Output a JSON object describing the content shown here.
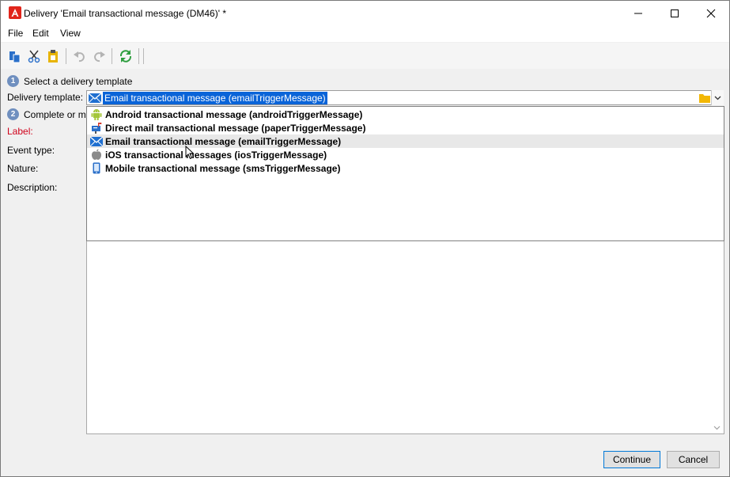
{
  "window": {
    "title": "Delivery 'Email transactional message (DM46)' *"
  },
  "menu": {
    "file": "File",
    "edit": "Edit",
    "view": "View"
  },
  "steps": {
    "step1": {
      "number": "1",
      "label": "Select a delivery template"
    },
    "step2": {
      "number": "2",
      "label": "Complete or m"
    }
  },
  "fields": {
    "delivery_template_label": "Delivery template:",
    "label_label": "Label:",
    "event_type_label": "Event type:",
    "nature_label": "Nature:",
    "description_label": "Description:"
  },
  "combo": {
    "selected_value": "Email transactional message (emailTriggerMessage)",
    "selected_icon": "envelope-icon"
  },
  "dropdown": {
    "items": [
      {
        "label": "Android transactional message (androidTriggerMessage)",
        "icon": "android-icon"
      },
      {
        "label": "Direct mail transactional message (paperTriggerMessage)",
        "icon": "mailbox-icon"
      },
      {
        "label": "Email transactional message (emailTriggerMessage)",
        "icon": "envelope-icon",
        "hovered": true
      },
      {
        "label": "iOS transactional messages (iosTriggerMessage)",
        "icon": "apple-icon"
      },
      {
        "label": "Mobile transactional message (smsTriggerMessage)",
        "icon": "mobile-phone-icon"
      }
    ]
  },
  "buttons": {
    "continue": "Continue",
    "cancel": "Cancel"
  },
  "colors": {
    "accent": "#0a64d8",
    "required_label": "#d0021b",
    "step_badge": "#6f8fbf"
  }
}
